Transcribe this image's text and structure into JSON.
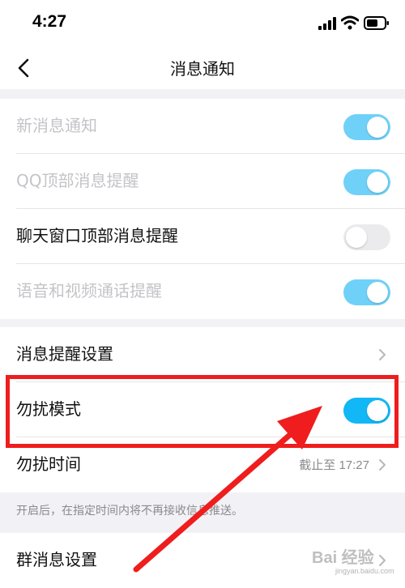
{
  "status_bar": {
    "time": "4:27"
  },
  "nav": {
    "title": "消息通知",
    "back_icon": "chevron-left-icon"
  },
  "group1": {
    "items": [
      {
        "label": "新消息通知",
        "toggle": "on",
        "disabled": true
      },
      {
        "label": "QQ顶部消息提醒",
        "toggle": "on",
        "disabled": true
      },
      {
        "label": "聊天窗口顶部消息提醒",
        "toggle": "off",
        "disabled": false
      },
      {
        "label": "语音和视频通话提醒",
        "toggle": "on",
        "disabled": true
      }
    ]
  },
  "group2": {
    "items": [
      {
        "label": "消息提醒设置"
      },
      {
        "label": "勿扰模式",
        "toggle": "on"
      },
      {
        "label": "勿扰时间",
        "value": "截止至 17:27"
      }
    ],
    "hint": "开启后，在指定时间内将不再接收信息推送。"
  },
  "group3": {
    "items": [
      {
        "label": "群消息设置"
      }
    ]
  },
  "annotation": {
    "highlight_color": "#ef1d1d"
  },
  "watermark": {
    "text": "Bai 经验",
    "sub": "jingyan.baidu.com"
  },
  "colors": {
    "toggle_on": "#12b7f5",
    "toggle_off": "#ebebee",
    "background": "#f2f2f6"
  }
}
